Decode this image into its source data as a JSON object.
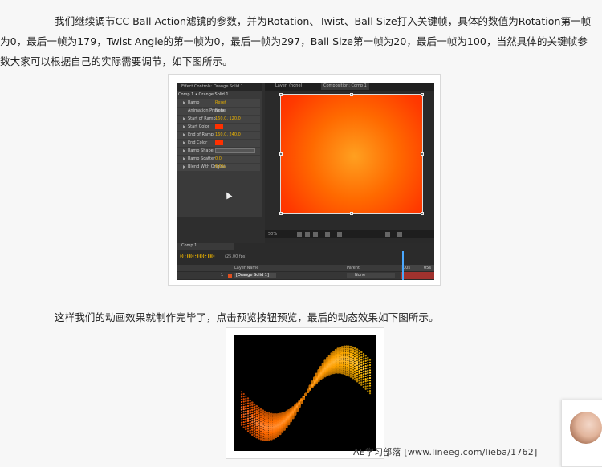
{
  "paragraph_1": "我们继续调节CC Ball Action滤镜的参数，并为Rotation、Twist、Ball Size打入关键帧，具体的数值为Rotation第一帧为0，最后一帧为179，Twist Angle的第一帧为0，最后一帧为297，Ball Size第一帧为20，最后一帧为100，当然具体的关键帧参数大家可以根据自己的实际需要调节，如下图所示。",
  "paragraph_2": "这样我们的动画效果就制作完毕了，点击预览按钮预览，最后的动态效果如下图所示。",
  "ae": {
    "effects_tab": "Effect Controls: Orange Solid 1",
    "effects_title": "Comp 1 • Orange Solid 1",
    "rows": [
      {
        "name": "Ramp",
        "value": "Reset"
      },
      {
        "name": "Animation Presets",
        "value": "None"
      },
      {
        "name": "Start of Ramp",
        "value": "160.0, 120.0"
      },
      {
        "name": "Start Color",
        "value": ""
      },
      {
        "name": "End of Ramp",
        "value": "160.0, 240.0"
      },
      {
        "name": "End Color",
        "value": ""
      },
      {
        "name": "Ramp Shape",
        "value": "Radial Ramp"
      },
      {
        "name": "Ramp Scatter",
        "value": "0.0"
      },
      {
        "name": "Blend With Original",
        "value": "0.0%"
      }
    ],
    "tab_layer": "Layer: (none)",
    "tab_composition": "Composition: Comp 1",
    "zoom": "50%",
    "timeline_tab": "Comp 1",
    "timecode": "0:00:00:00",
    "frame_info": "(25.00 fps)",
    "layer_header": "Layer Name",
    "parent_header": "Parent",
    "layer_number": "1",
    "layer_name": "[Orange Solid 1]",
    "layer_parent": "None",
    "ruler_start": "00s",
    "ruler_end": "05s",
    "colors": {
      "start": "#ff3000",
      "end": "#ffa020",
      "accent": "#e8b000"
    }
  },
  "watermark": "AE学习部落   [www.lineeg.com/lieba/1762]"
}
